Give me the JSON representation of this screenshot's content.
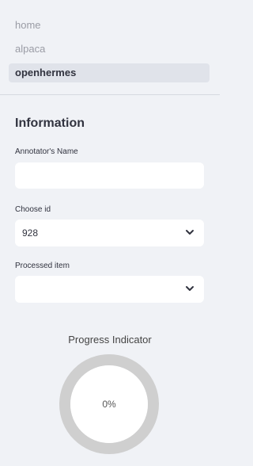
{
  "nav": {
    "items": [
      {
        "label": "home",
        "active": false
      },
      {
        "label": "alpaca",
        "active": false
      },
      {
        "label": "openhermes",
        "active": true
      }
    ]
  },
  "information": {
    "title": "Information",
    "annotator_name": {
      "label": "Annotator's Name",
      "value": "",
      "placeholder": ""
    },
    "choose_id": {
      "label": "Choose id",
      "value": "928"
    },
    "processed_item": {
      "label": "Processed item",
      "value": ""
    }
  },
  "progress": {
    "title": "Progress Indicator",
    "percent_text": "0%",
    "value": 0
  },
  "colors": {
    "sidebar_bg": "#f0f2f6",
    "gauge_track": "#cfcfcf",
    "gauge_center": "#ffffff"
  },
  "icons": {
    "dropdown": "chevron-down-icon"
  }
}
